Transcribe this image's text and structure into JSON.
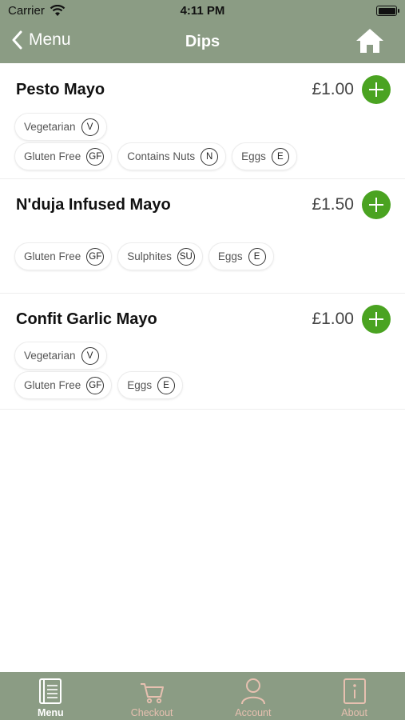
{
  "status_bar": {
    "carrier": "Carrier",
    "time": "4:11 PM"
  },
  "nav": {
    "back_label": "Menu",
    "title": "Dips"
  },
  "items": [
    {
      "name": "Pesto Mayo",
      "price": "£1.00",
      "tags": [
        [
          {
            "label": "Vegetarian",
            "code": "V"
          }
        ],
        [
          {
            "label": "Gluten Free",
            "code": "GF"
          },
          {
            "label": "Contains Nuts",
            "code": "N"
          },
          {
            "label": "Eggs",
            "code": "E"
          }
        ]
      ]
    },
    {
      "name": "N'duja Infused Mayo",
      "price": "£1.50",
      "tags": [
        [
          {
            "label": "Gluten Free",
            "code": "GF"
          },
          {
            "label": "Sulphites",
            "code": "SU"
          },
          {
            "label": "Eggs",
            "code": "E"
          }
        ]
      ]
    },
    {
      "name": "Confit Garlic Mayo",
      "price": "£1.00",
      "tags": [
        [
          {
            "label": "Vegetarian",
            "code": "V"
          }
        ],
        [
          {
            "label": "Gluten Free",
            "code": "GF"
          },
          {
            "label": "Eggs",
            "code": "E"
          }
        ]
      ]
    }
  ],
  "tabbar": [
    {
      "label": "Menu",
      "icon": "menu-book-icon",
      "active": true
    },
    {
      "label": "Checkout",
      "icon": "cart-icon",
      "active": false
    },
    {
      "label": "Account",
      "icon": "person-icon",
      "active": false
    },
    {
      "label": "About",
      "icon": "info-icon",
      "active": false
    }
  ],
  "colors": {
    "header": "#8b9c84",
    "accent": "#4aa321",
    "tab_active": "#ffffff",
    "tab_inactive": "#e7c0b0"
  }
}
